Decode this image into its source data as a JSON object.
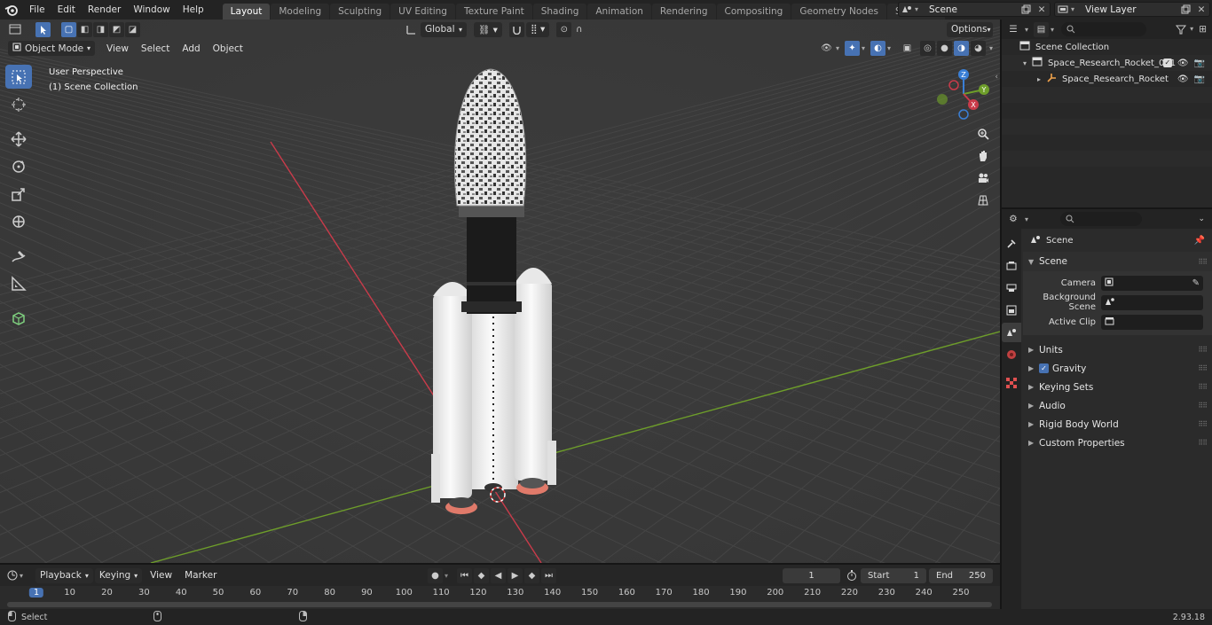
{
  "topbar": {
    "menus": [
      "File",
      "Edit",
      "Render",
      "Window",
      "Help"
    ],
    "workspaces": [
      "Layout",
      "Modeling",
      "Sculpting",
      "UV Editing",
      "Texture Paint",
      "Shading",
      "Animation",
      "Rendering",
      "Compositing",
      "Geometry Nodes",
      "Scripting"
    ],
    "active_workspace": "Layout",
    "add_label": "+",
    "scene_name": "Scene",
    "view_layer_name": "View Layer"
  },
  "viewport": {
    "transform_orientation": "Global",
    "options_label": "Options",
    "mode_label": "Object Mode",
    "menus": [
      "View",
      "Select",
      "Add",
      "Object"
    ],
    "perspective_label": "User Perspective",
    "collection_label": "(1) Scene Collection",
    "gizmo_axes": {
      "x": "X",
      "y": "Y",
      "z": "Z"
    }
  },
  "outliner": {
    "rows": [
      {
        "label": "Scene Collection"
      },
      {
        "label": "Space_Research_Rocket_001"
      },
      {
        "label": "Space_Research_Rocket"
      }
    ]
  },
  "properties": {
    "context_label": "Scene",
    "section_title": "Scene",
    "fields": [
      {
        "label": "Camera"
      },
      {
        "label": "Background Scene"
      },
      {
        "label": "Active Clip"
      }
    ],
    "panels": [
      "Units",
      "Gravity",
      "Keying Sets",
      "Audio",
      "Rigid Body World",
      "Custom Properties"
    ],
    "gravity_checked": true
  },
  "timeline": {
    "menus": [
      "Playback",
      "Keying",
      "View",
      "Marker"
    ],
    "current_frame": "1",
    "start_label": "Start",
    "start_value": "1",
    "end_label": "End",
    "end_value": "250",
    "ruler_ticks": [
      "1",
      "10",
      "20",
      "30",
      "40",
      "50",
      "60",
      "70",
      "80",
      "90",
      "100",
      "110",
      "120",
      "130",
      "140",
      "150",
      "160",
      "170",
      "180",
      "190",
      "200",
      "210",
      "220",
      "230",
      "240",
      "250"
    ]
  },
  "statusbar": {
    "left_label": "Select",
    "version": "2.93.18"
  },
  "colors": {
    "accent": "#4772b3",
    "axis_x": "#c93b4a",
    "axis_y": "#6e9e2a",
    "axis_z": "#3a7fd6",
    "viewport_bg": "#393939"
  }
}
